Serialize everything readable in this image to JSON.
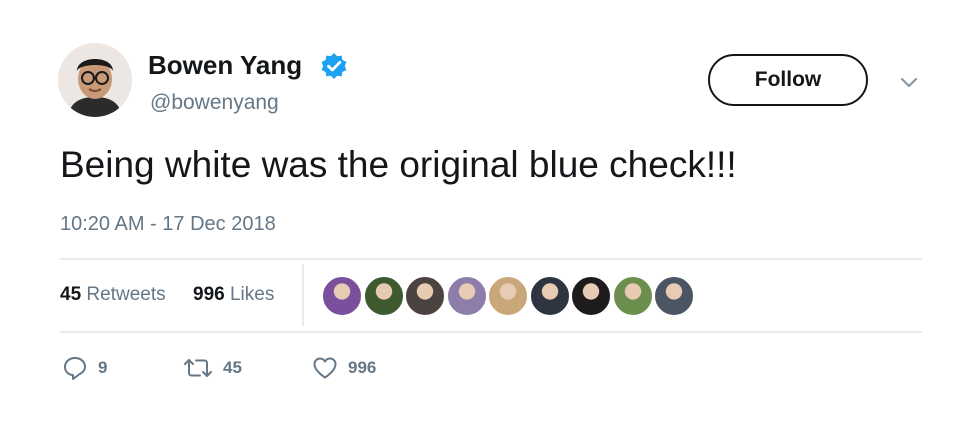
{
  "user": {
    "display_name": "Bowen Yang",
    "handle": "@bowenyang",
    "verified": true,
    "verified_color": "#1da1f2"
  },
  "follow_button": {
    "label": "Follow"
  },
  "tweet": {
    "text": "Being white was the original blue check!!!",
    "timestamp": "10:20 AM - 17 Dec 2018"
  },
  "stats": {
    "retweets_count": "45",
    "retweets_label": "Retweets",
    "likes_count": "996",
    "likes_label": "Likes"
  },
  "liked_by_avatars": [
    {
      "icon": "avatar-1",
      "color": "#7a4f9c"
    },
    {
      "icon": "avatar-2",
      "color": "#3f5a2e"
    },
    {
      "icon": "avatar-3",
      "color": "#4a4340"
    },
    {
      "icon": "avatar-4",
      "color": "#8c7ea8"
    },
    {
      "icon": "avatar-5",
      "color": "#c9a77a"
    },
    {
      "icon": "avatar-6",
      "color": "#2e3440"
    },
    {
      "icon": "avatar-7",
      "color": "#1e1b1c"
    },
    {
      "icon": "avatar-8",
      "color": "#6d8f4e"
    },
    {
      "icon": "avatar-9",
      "color": "#4b5563"
    }
  ],
  "actions": {
    "reply_count": "9",
    "retweet_count": "45",
    "like_count": "996"
  },
  "colors": {
    "text_primary": "#14171a",
    "text_secondary": "#657786",
    "divider": "#e6ecf0"
  }
}
